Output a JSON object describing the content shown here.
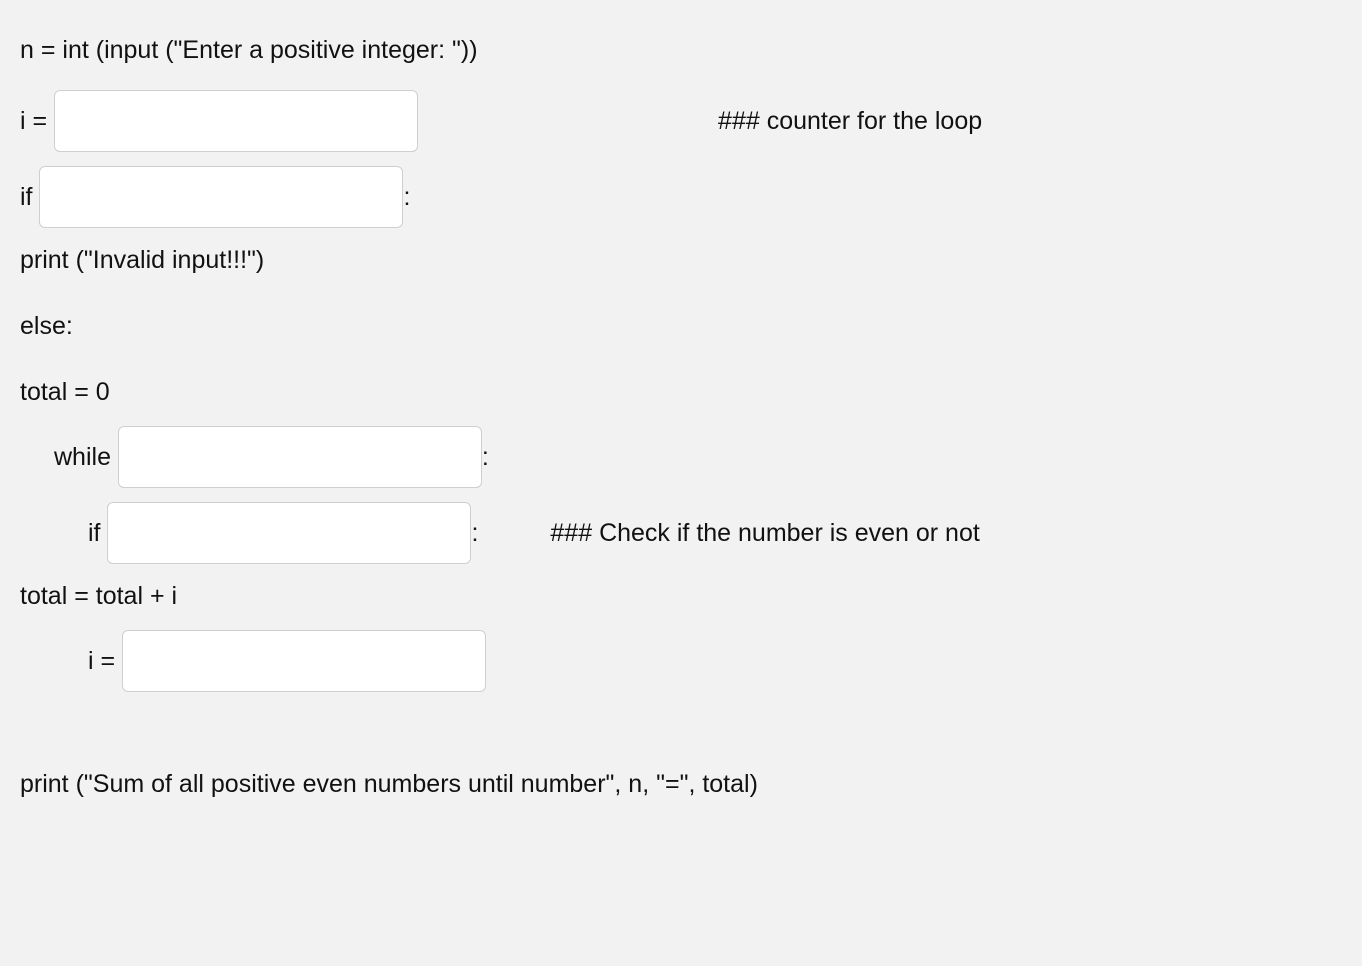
{
  "code": {
    "line1": "n = int (input (\"Enter a positive integer: \"))",
    "i_eq": "i = ",
    "comment_counter": "### counter for the loop",
    "if_kw": "if ",
    "colon": ":",
    "print_invalid": "print (\"Invalid input!!!\")",
    "else_line": "else:",
    "total_init": "total = 0",
    "while_kw": "while ",
    "if2_kw": "if ",
    "comment_even": "### Check if the number is even or not",
    "total_accum": "total = total + i",
    "i2_eq": "i = ",
    "print_final": "print (\"Sum of all positive even numbers until number\", n, \"=\", total)"
  },
  "blanks": {
    "b1": "",
    "b2": "",
    "b3": "",
    "b4": "",
    "b5": ""
  }
}
